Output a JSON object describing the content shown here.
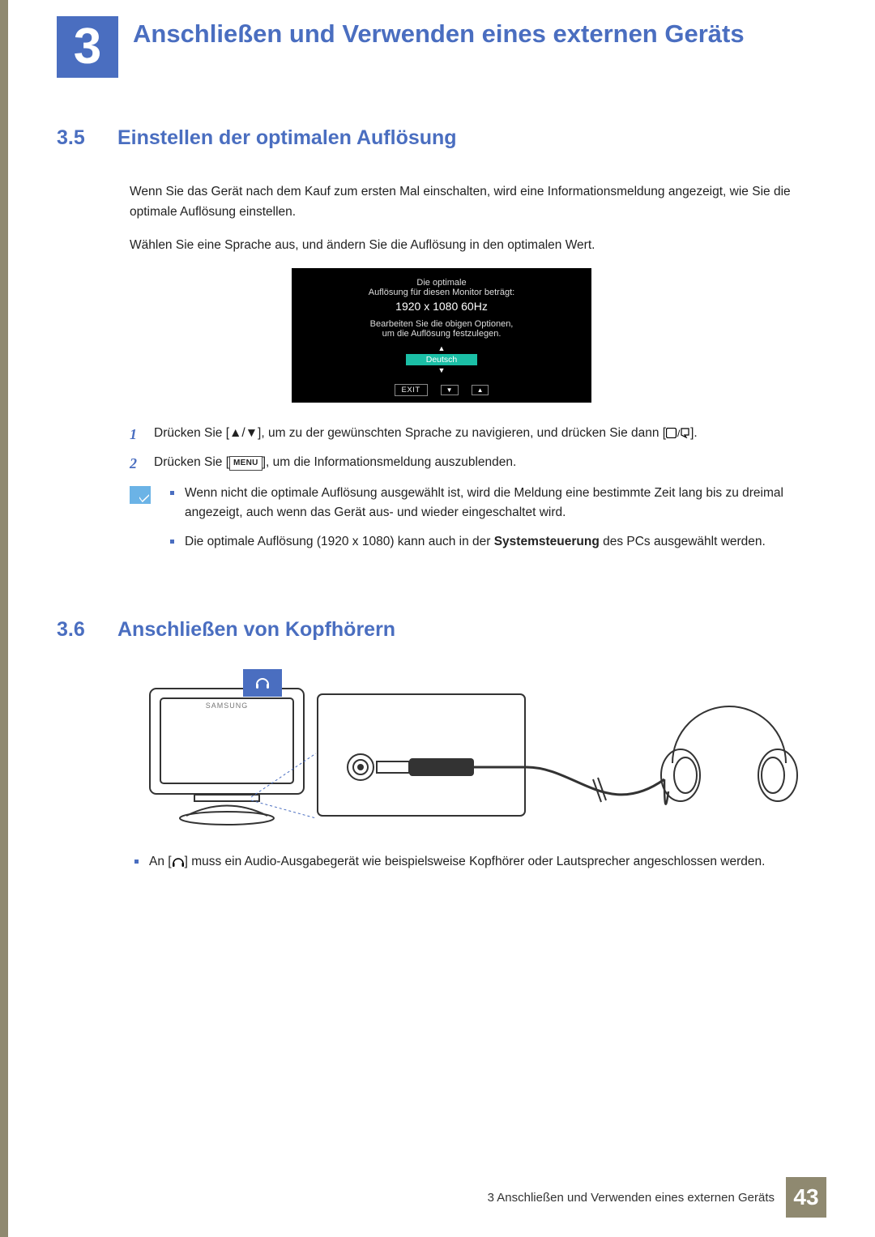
{
  "chapter": {
    "number": "3",
    "title": "Anschließen und Verwenden eines externen Geräts"
  },
  "section1": {
    "number": "3.5",
    "title": "Einstellen der optimalen Auflösung",
    "para1": "Wenn Sie das Gerät nach dem Kauf zum ersten Mal einschalten, wird eine Informationsmeldung angezeigt, wie Sie die optimale Auflösung einstellen.",
    "para2": "Wählen Sie eine Sprache aus, und ändern Sie die Auflösung in den optimalen Wert."
  },
  "osd": {
    "line1": "Die optimale",
    "line2": "Auflösung für diesen Monitor beträgt:",
    "resolution": "1920 x 1080  60Hz",
    "line3": "Bearbeiten Sie die obigen Optionen,",
    "line4": "um die Auflösung festzulegen.",
    "language": "Deutsch",
    "exit": "EXIT"
  },
  "steps": {
    "s1_a": "Drücken Sie [",
    "s1_b": "], um zu der gewünschten Sprache zu navigieren, und drücken Sie dann [",
    "s1_c": "].",
    "s2_a": "Drücken Sie [",
    "s2_menu": "MENU",
    "s2_b": "], um die Informationsmeldung auszublenden."
  },
  "notes": {
    "n1": "Wenn nicht die optimale Auflösung ausgewählt ist, wird die Meldung eine bestimmte Zeit lang bis zu dreimal angezeigt, auch wenn das Gerät aus- und wieder eingeschaltet wird.",
    "n2_a": "Die optimale Auflösung (1920 x 1080) kann auch in der ",
    "n2_bold": "Systemsteuerung",
    "n2_b": " des PCs ausgewählt werden."
  },
  "section2": {
    "number": "3.6",
    "title": "Anschließen von Kopfhörern",
    "bullet_a": "An [",
    "bullet_b": "] muss ein Audio-Ausgabegerät wie beispielsweise Kopfhörer oder Lautsprecher angeschlossen werden."
  },
  "footer": {
    "text": "3 Anschließen und Verwenden eines externen Geräts",
    "page": "43"
  }
}
